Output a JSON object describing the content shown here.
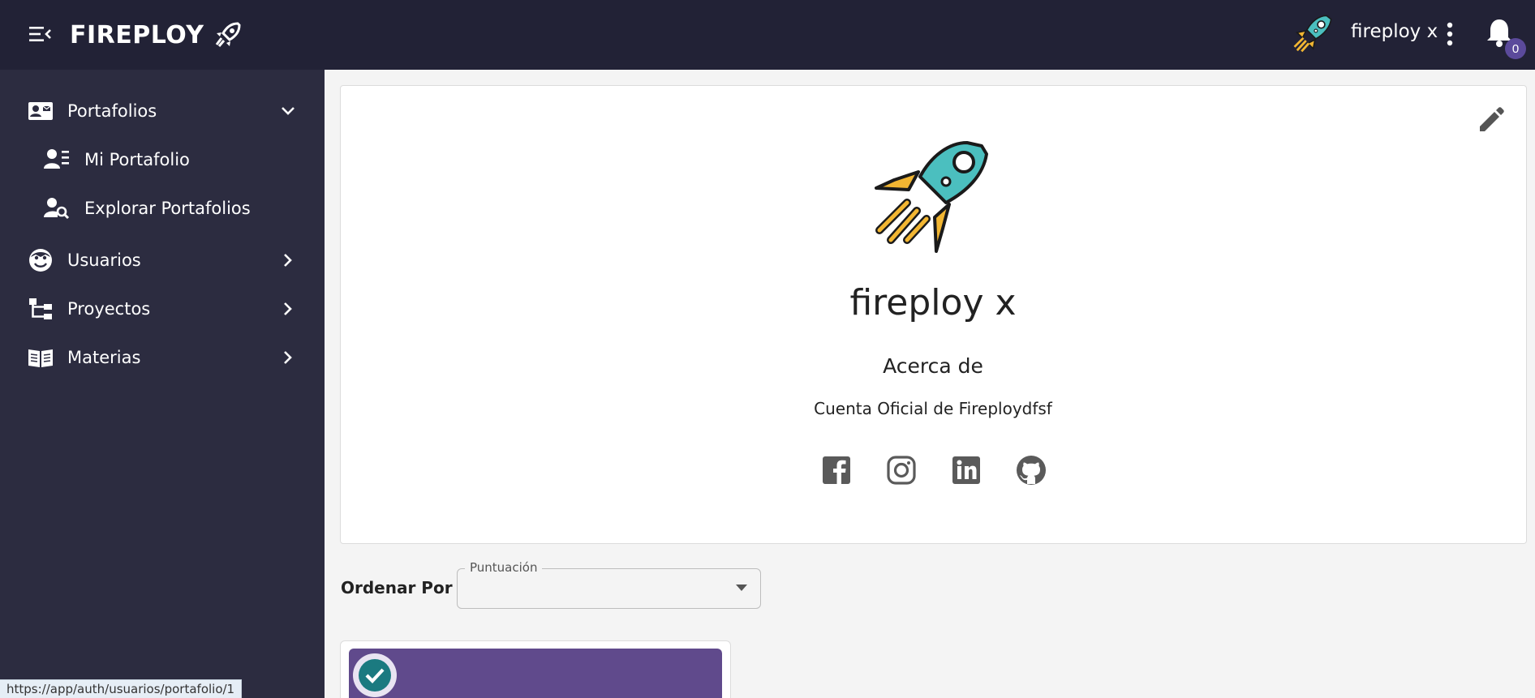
{
  "header": {
    "brand": "FIREPLOY",
    "username": "fireploy x",
    "notification_count": "0"
  },
  "sidebar": {
    "items": [
      {
        "label": "Portafolios",
        "icon": "portfolio-card-icon",
        "expanded": true
      },
      {
        "label": "Mi Portafolio",
        "icon": "user-list-icon"
      },
      {
        "label": "Explorar Portafolios",
        "icon": "user-search-icon"
      },
      {
        "label": "Usuarios",
        "icon": "face-icon",
        "expanded": false
      },
      {
        "label": "Proyectos",
        "icon": "hierarchy-icon",
        "expanded": false
      },
      {
        "label": "Materias",
        "icon": "book-icon",
        "expanded": false
      }
    ]
  },
  "profile": {
    "name": "fireploy x",
    "about_title": "Acerca de",
    "about_text": "Cuenta Oficial de Fireploydfsf",
    "socials": [
      "facebook-icon",
      "instagram-icon",
      "linkedin-icon",
      "github-icon"
    ]
  },
  "sort": {
    "label": "Ordenar Por",
    "field_label": "Puntuación",
    "value": ""
  },
  "status_bar": {
    "url": "https://app/auth/usuarios/portafolio/1"
  },
  "colors": {
    "topbar": "#222236",
    "sidebar": "#2c2c40",
    "badge": "#5b4a9b",
    "rocket_body": "#4bbfbf",
    "rocket_fins": "#f2b632",
    "project_banner": "#604a8c",
    "check": "#1b7a80"
  }
}
